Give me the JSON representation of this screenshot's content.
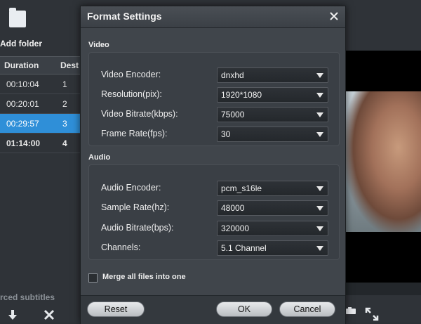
{
  "background": {
    "add_folder_label": "Add folder",
    "table": {
      "col_duration": "Duration",
      "col_dest": "Dest",
      "rows": [
        {
          "duration": "00:10:04",
          "dest": "1"
        },
        {
          "duration": "00:20:01",
          "dest": "2"
        },
        {
          "duration": "00:29:57",
          "dest": "3"
        },
        {
          "duration": "01:14:00",
          "dest": "4"
        }
      ],
      "selected_row": 2
    },
    "forced_subtitles_label": "rced subtitles",
    "icons": {
      "add_folder": "folder-icon",
      "move_down": "down-arrow-icon",
      "delete": "delete-x-icon",
      "snapshot": "snapshot-icon",
      "fullscreen": "fullscreen-icon"
    }
  },
  "dialog": {
    "title": "Format Settings",
    "close_icon": "close-icon",
    "video": {
      "section_title": "Video",
      "fields": [
        {
          "label": "Video Encoder:",
          "value": "dnxhd"
        },
        {
          "label": "Resolution(pix):",
          "value": "1920*1080"
        },
        {
          "label": "Video Bitrate(kbps):",
          "value": "75000"
        },
        {
          "label": "Frame Rate(fps):",
          "value": "30"
        }
      ]
    },
    "audio": {
      "section_title": "Audio",
      "fields": [
        {
          "label": "Audio Encoder:",
          "value": "pcm_s16le"
        },
        {
          "label": "Sample Rate(hz):",
          "value": "48000"
        },
        {
          "label": "Audio Bitrate(bps):",
          "value": "320000"
        },
        {
          "label": "Channels:",
          "value": "5.1 Channel"
        }
      ]
    },
    "merge_label": "Merge all files into one",
    "merge_checked": false,
    "buttons": {
      "reset": "Reset",
      "ok": "OK",
      "cancel": "Cancel"
    }
  },
  "colors": {
    "selection": "#2f8fd8",
    "dialog_bg": "#40454b",
    "titlebar": "#3b4046"
  }
}
